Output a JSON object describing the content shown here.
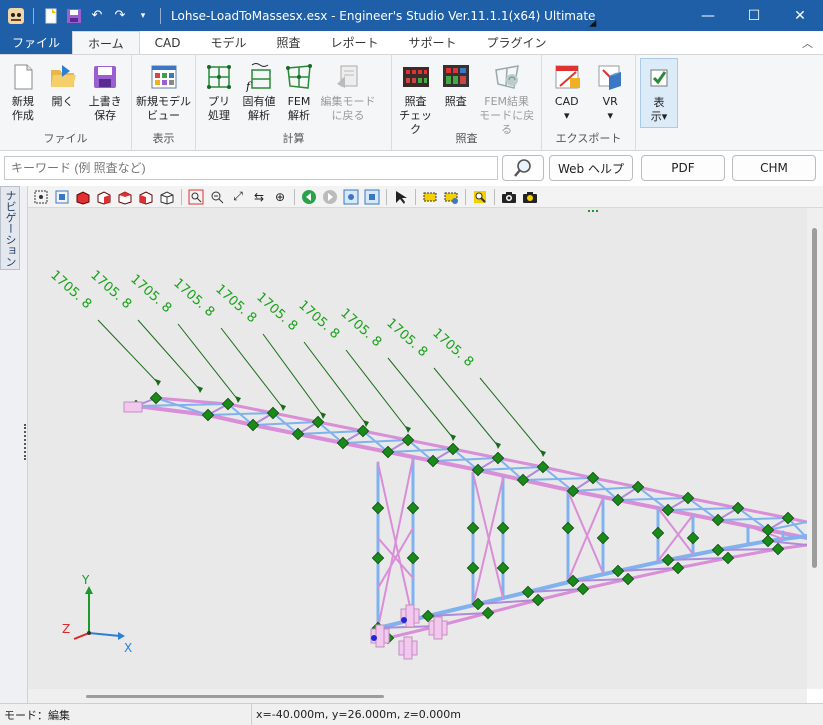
{
  "app": {
    "title": "Lohse-LoadToMassesx.esx - Engineer's Studio Ver.11.1.1(x64) Ultimate",
    "accent": "#1f5fa8"
  },
  "window_controls": {
    "minimize": "—",
    "maximize": "☐",
    "close": "✕"
  },
  "menu": {
    "tabs": [
      "ファイル",
      "ホーム",
      "CAD",
      "モデル",
      "照査",
      "レポート",
      "サポート",
      "プラグイン"
    ],
    "active": "ホーム"
  },
  "ribbon": {
    "groups": [
      {
        "label": "ファイル",
        "buttons": [
          {
            "label": "新規\n作成",
            "icon": "new-file-icon"
          },
          {
            "label": "開く",
            "icon": "open-folder-icon"
          },
          {
            "label": "上書き\n保存",
            "icon": "save-icon"
          }
        ]
      },
      {
        "label": "表示",
        "buttons": [
          {
            "label": "新規モデル\nビュー",
            "icon": "model-view-icon"
          }
        ]
      },
      {
        "label": "計算",
        "buttons": [
          {
            "label": "プリ\n処理",
            "icon": "pre-process-icon"
          },
          {
            "label": "固有値\n解析",
            "icon": "eigen-analysis-icon"
          },
          {
            "label": "FEM\n解析",
            "icon": "fem-analysis-icon"
          },
          {
            "label": "編集モード\nに戻る",
            "icon": "edit-mode-icon",
            "disabled": true
          }
        ]
      },
      {
        "label": "照査",
        "buttons": [
          {
            "label": "照査\nチェック",
            "icon": "check-icon"
          },
          {
            "label": "照査",
            "icon": "verify-icon"
          },
          {
            "label": "FEM結果\nモードに戻る",
            "icon": "fem-result-icon",
            "disabled": true
          }
        ]
      },
      {
        "label": "エクスポート",
        "buttons": [
          {
            "label": "CAD\n▾",
            "icon": "cad-export-icon"
          },
          {
            "label": "VR\n▾",
            "icon": "vr-export-icon"
          }
        ]
      },
      {
        "label": "",
        "buttons": [
          {
            "label": "表\n示▾",
            "icon": "display-toggle-icon",
            "pressed": true
          }
        ]
      }
    ]
  },
  "search": {
    "placeholder": "キーワード (例 照査など)",
    "web_help": "Web ヘルプ",
    "pdf": "PDF",
    "chm": "CHM"
  },
  "navigation_tab": "ナビゲーション",
  "viewport": {
    "load_label": "1705. 8",
    "load_count": 10,
    "axis": {
      "x": "X",
      "y": "Y",
      "z": "Z"
    }
  },
  "status": {
    "mode": "モード：編集",
    "coords": "x=-40.000m, y=26.000m, z=0.000m"
  }
}
